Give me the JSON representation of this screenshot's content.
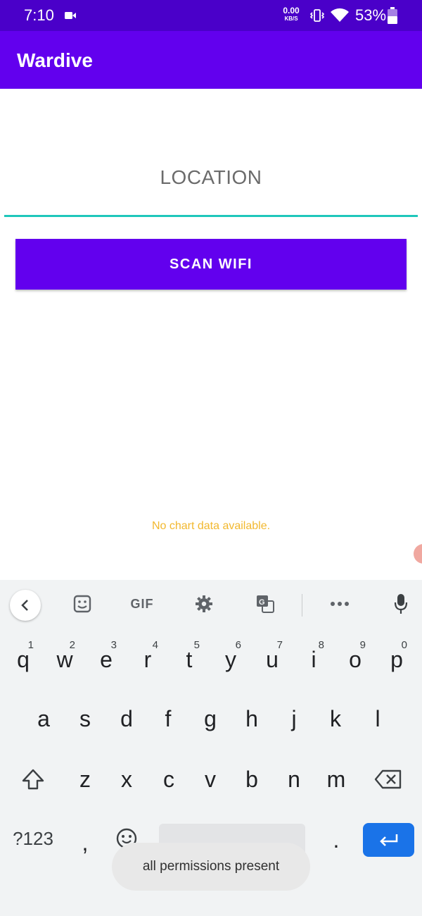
{
  "status_bar": {
    "time": "7:10",
    "net_speed": "0.00",
    "net_unit": "KB/S",
    "battery": "53%",
    "icons": [
      "video-icon",
      "vibrate-icon",
      "wifi-icon",
      "battery-icon"
    ]
  },
  "app": {
    "title": "Wardive",
    "accent_color": "#6200ee",
    "input_underline_color": "#1fc7bb"
  },
  "form": {
    "location_placeholder": "LOCATION",
    "location_value": "",
    "scan_button_label": "SCAN WIFI"
  },
  "chart": {
    "empty_message": "No chart data available."
  },
  "keyboard": {
    "toolbar_gif": "GIF",
    "row1": [
      {
        "key": "q",
        "hint": "1"
      },
      {
        "key": "w",
        "hint": "2"
      },
      {
        "key": "e",
        "hint": "3"
      },
      {
        "key": "r",
        "hint": "4"
      },
      {
        "key": "t",
        "hint": "5"
      },
      {
        "key": "y",
        "hint": "6"
      },
      {
        "key": "u",
        "hint": "7"
      },
      {
        "key": "i",
        "hint": "8"
      },
      {
        "key": "o",
        "hint": "9"
      },
      {
        "key": "p",
        "hint": "0"
      }
    ],
    "row2": [
      "a",
      "s",
      "d",
      "f",
      "g",
      "h",
      "j",
      "k",
      "l"
    ],
    "row3": [
      "z",
      "x",
      "c",
      "v",
      "b",
      "n",
      "m"
    ],
    "symbols_key": "?123",
    "comma_key": ",",
    "period_key": "."
  },
  "toast": {
    "message": "all permissions present"
  }
}
